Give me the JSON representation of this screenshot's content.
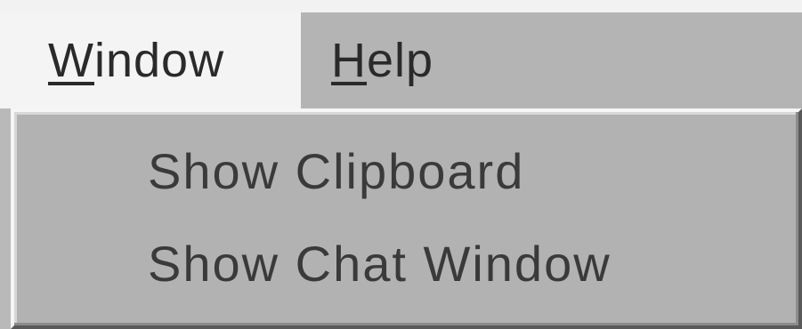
{
  "menubar": {
    "items": [
      {
        "label_mnemonic": "W",
        "label_rest": "indow"
      },
      {
        "label_mnemonic": "H",
        "label_rest": "elp"
      }
    ]
  },
  "dropdown": {
    "items": [
      {
        "label": "Show Clipboard"
      },
      {
        "label": "Show Chat Window"
      }
    ]
  }
}
